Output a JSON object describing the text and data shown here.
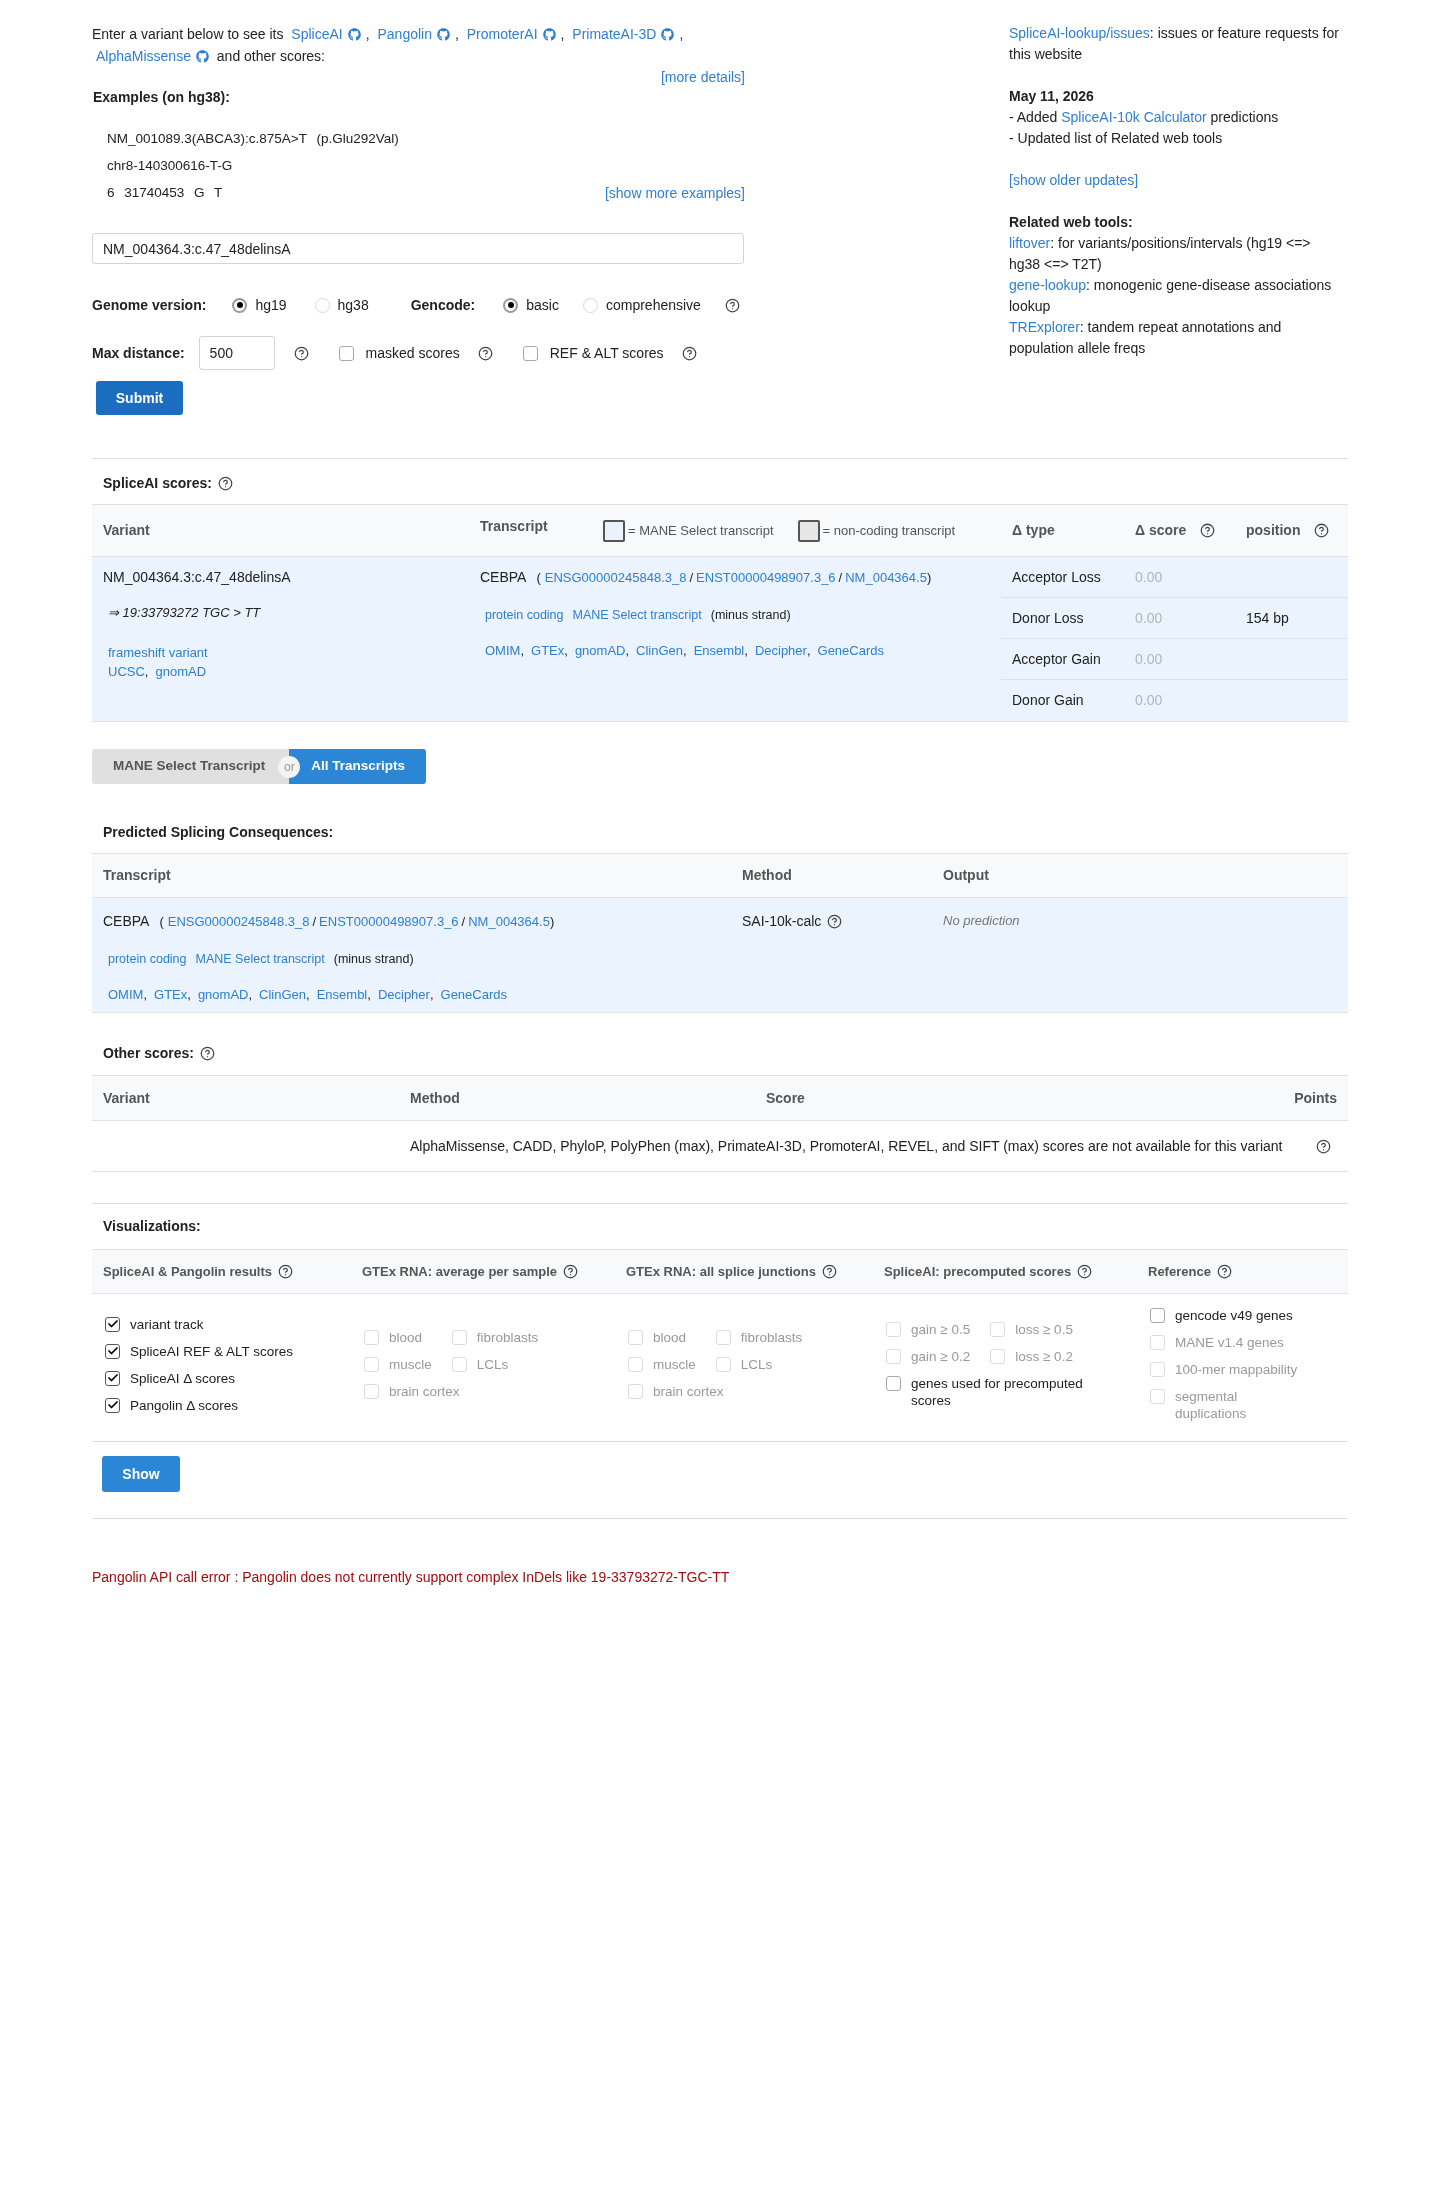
{
  "intro": {
    "lead": "Enter a variant below to see its",
    "tools": [
      {
        "label": "SpliceAI",
        "after": ","
      },
      {
        "label": "Pangolin",
        "after": ","
      },
      {
        "label": "PromoterAI",
        "after": ","
      },
      {
        "label": "PrimateAI-3D",
        "after": ","
      },
      {
        "label": "AlphaMissense"
      }
    ],
    "tail": "and other scores:"
  },
  "more_details": "[more details]",
  "examples": {
    "title": "Examples (on hg38):",
    "items": [
      "NM_001089.3(ABCA3):c.875A>T (p.Glu292Val)",
      "chr8-140300616-T-G",
      "6 31740453 G T"
    ],
    "more_link": "[show more examples]"
  },
  "variant_input": {
    "value": "NM_004364.3:c.47_48delinsA"
  },
  "genome_version": {
    "label": "Genome version:",
    "options": [
      {
        "label": "hg19",
        "selected": true
      },
      {
        "label": "hg38",
        "selected": false
      }
    ]
  },
  "gencode": {
    "label": "Gencode:",
    "options": [
      {
        "label": "basic",
        "selected": true
      },
      {
        "label": "comprehensive",
        "selected": false
      }
    ]
  },
  "max_distance": {
    "label": "Max distance:",
    "value": "500"
  },
  "score_options": [
    {
      "label": "masked scores",
      "checked": false
    },
    {
      "label": "REF & ALT scores",
      "checked": false
    }
  ],
  "submit_button": "Submit",
  "sidebar": {
    "issues": {
      "link": "SpliceAI-lookup/issues",
      "text": ": issues or feature requests for this website"
    },
    "update": {
      "date": "May 11, 2026",
      "items": [
        {
          "text": "- Added",
          "link": "SpliceAI-10k Calculator",
          "tail": "predictions"
        },
        {
          "text": "- Updated list of Related web tools"
        }
      ]
    },
    "older_link": "[show older updates]",
    "related": {
      "title": "Related web tools:",
      "items": [
        {
          "link": "liftover",
          "text": ": for variants/positions/intervals (hg19 <=> hg38 <=> T2T)"
        },
        {
          "link": "gene-lookup",
          "text": ": monogenic gene-disease associations lookup"
        },
        {
          "link": "TRExplorer",
          "text": ": tandem repeat annotations and population allele freqs"
        }
      ]
    }
  },
  "spliceai_scores": {
    "title": "SpliceAI scores:",
    "columns": [
      {
        "label": "Variant",
        "help": false
      },
      {
        "label": "Transcript",
        "help": false
      },
      {
        "label": "Δ type",
        "help": false
      },
      {
        "label": "Δ score",
        "help": true
      },
      {
        "label": "position",
        "help": true
      }
    ],
    "legend": [
      {
        "label": "= MANE Select transcript",
        "color": "#eaf2fe"
      },
      {
        "label": "= non-coding transcript",
        "color": "#e6e6e6"
      }
    ],
    "variant": {
      "name": "NM_004364.3:c.47_48delinsA",
      "genomic": "⇒ 19:33793272 TGC > TT",
      "consequence": "frameshift variant",
      "links": [
        {
          "label": "UCSC",
          "after": ","
        },
        {
          "label": "gnomAD"
        }
      ]
    },
    "transcript": {
      "gene": "CEBPA",
      "open": "(",
      "ids": [
        "ENSG00000245848.3_8",
        "ENST00000498907.3_6",
        "NM_004364.5"
      ],
      "separator": "/",
      "close": ")",
      "tags": [
        "protein coding",
        "MANE Select transcript"
      ],
      "strand": "(minus strand)",
      "links": [
        {
          "label": "OMIM",
          "after": ","
        },
        {
          "label": "GTEx",
          "after": ","
        },
        {
          "label": "gnomAD",
          "after": ","
        },
        {
          "label": "ClinGen",
          "after": ","
        },
        {
          "label": "Ensembl",
          "after": ","
        },
        {
          "label": "Decipher",
          "after": ","
        },
        {
          "label": "GeneCards"
        }
      ]
    },
    "rows": [
      {
        "type": "Acceptor Loss",
        "score": "0.00"
      },
      {
        "type": "Donor Loss",
        "score": "0.00",
        "position": "154 bp"
      },
      {
        "type": "Acceptor Gain",
        "score": "0.00"
      },
      {
        "type": "Donor Gain",
        "score": "0.00"
      }
    ]
  },
  "transcript_toggle": {
    "options": [
      {
        "label": "MANE Select Transcript",
        "selected": false
      },
      {
        "label": "All Transcripts",
        "selected": true
      }
    ],
    "or": "or"
  },
  "predicted": {
    "title": "Predicted Splicing Consequences:",
    "columns": [
      "Transcript",
      "Method",
      "Output"
    ],
    "rows": [
      {
        "transcript": {
          "gene": "CEBPA",
          "open": "(",
          "ids": [
            "ENSG00000245848.3_8",
            "ENST00000498907.3_6",
            "NM_004364.5"
          ],
          "separator": "/",
          "close": ")",
          "tags": [
            "protein coding",
            "MANE Select transcript"
          ],
          "strand": "(minus strand)",
          "links": [
            {
              "label": "OMIM",
              "after": ","
            },
            {
              "label": "GTEx",
              "after": ","
            },
            {
              "label": "gnomAD",
              "after": ","
            },
            {
              "label": "ClinGen",
              "after": ","
            },
            {
              "label": "Ensembl",
              "after": ","
            },
            {
              "label": "Decipher",
              "after": ","
            },
            {
              "label": "GeneCards"
            }
          ]
        },
        "method": "SAI-10k-calc",
        "output": "No prediction"
      }
    ]
  },
  "other_scores": {
    "title": "Other scores:",
    "columns": [
      "Variant",
      "Method",
      "Score",
      "Points"
    ],
    "message": "AlphaMissense, CADD, PhyloP, PolyPhen (max), PrimateAI-3D, PromoterAI, REVEL, and SIFT (max) scores are not available for this variant"
  },
  "visualizations": {
    "title": "Visualizations:",
    "groups": [
      {
        "title": "SpliceAI & Pangolin results",
        "kind": "list",
        "options": [
          {
            "label": "variant track",
            "checked": true,
            "disabled": false
          },
          {
            "label": "SpliceAI REF & ALT scores",
            "checked": true,
            "disabled": false
          },
          {
            "label": "SpliceAI Δ scores",
            "checked": true,
            "disabled": false
          },
          {
            "label": "Pangolin Δ scores",
            "checked": true,
            "disabled": false
          }
        ]
      },
      {
        "title": "GTEx RNA: average per sample",
        "kind": "grid",
        "options": [
          {
            "label": "blood",
            "checked": false,
            "disabled": true
          },
          {
            "label": "fibroblasts",
            "checked": false,
            "disabled": true
          },
          {
            "label": "muscle",
            "checked": false,
            "disabled": true
          },
          {
            "label": "LCLs",
            "checked": false,
            "disabled": true
          },
          {
            "label": "brain cortex",
            "checked": false,
            "disabled": true
          }
        ]
      },
      {
        "title": "GTEx RNA: all splice junctions",
        "kind": "grid",
        "options": [
          {
            "label": "blood",
            "checked": false,
            "disabled": true
          },
          {
            "label": "fibroblasts",
            "checked": false,
            "disabled": true
          },
          {
            "label": "muscle",
            "checked": false,
            "disabled": true
          },
          {
            "label": "LCLs",
            "checked": false,
            "disabled": true
          },
          {
            "label": "brain cortex",
            "checked": false,
            "disabled": true
          }
        ]
      },
      {
        "title": "SpliceAI: precomputed scores",
        "kind": "grid",
        "options": [
          {
            "label": "gain ≥ 0.5",
            "checked": false,
            "disabled": true
          },
          {
            "label": "loss ≥ 0.5",
            "checked": false,
            "disabled": true
          },
          {
            "label": "gain ≥ 0.2",
            "checked": false,
            "disabled": true
          },
          {
            "label": "loss ≥ 0.2",
            "checked": false,
            "disabled": true
          },
          {
            "label": "genes used for precomputed scores",
            "checked": false,
            "disabled": false
          }
        ]
      },
      {
        "title": "Reference",
        "kind": "list",
        "options": [
          {
            "label": "gencode v49 genes",
            "checked": false,
            "disabled": false
          },
          {
            "label": "MANE v1.4 genes",
            "checked": false,
            "disabled": true
          },
          {
            "label": "100-mer mappability",
            "checked": false,
            "disabled": true
          },
          {
            "label": "segmental duplications",
            "checked": false,
            "disabled": true
          }
        ]
      }
    ]
  },
  "show_button": "Show",
  "error_message": "Pangolin API call error : Pangolin does not currently support complex InDels like 19-33793272-TGC-TT"
}
